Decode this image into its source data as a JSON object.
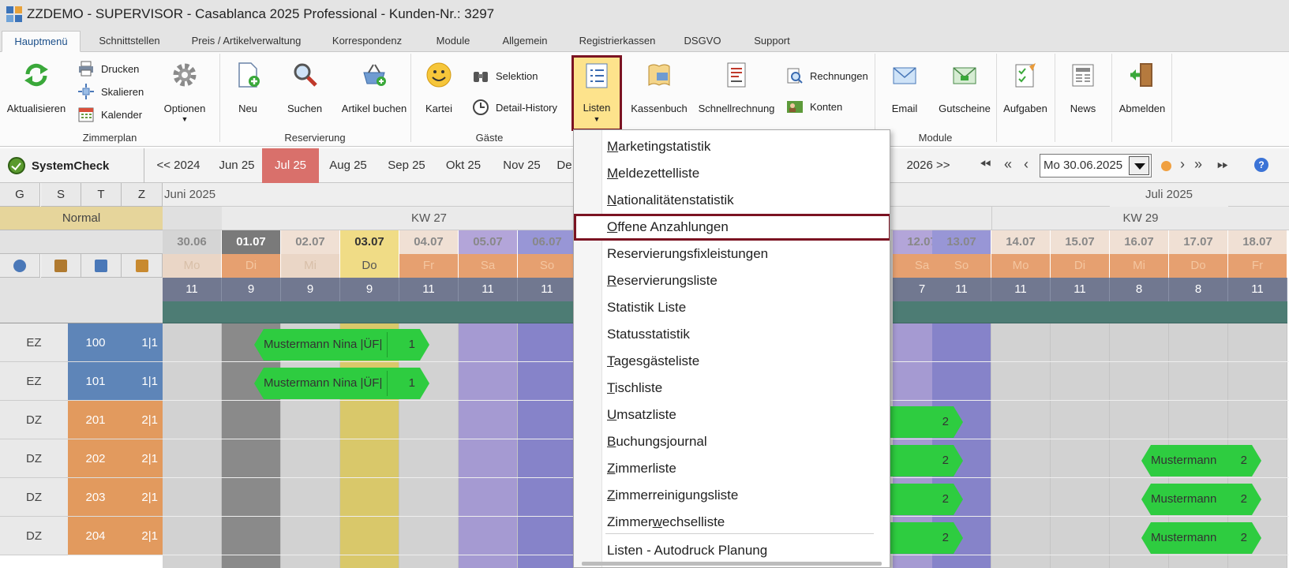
{
  "window": {
    "title": "ZZDEMO - SUPERVISOR - Casablanca 2025 Professional -  Kunden-Nr.: 3297"
  },
  "tabs": [
    "Hauptmenü",
    "Schnittstellen",
    "Preis / Artikelverwaltung",
    "Korrespondenz",
    "Module",
    "Allgemein",
    "Registrierkassen",
    "DSGVO",
    "Support"
  ],
  "ribbon": {
    "aktualisieren": "Aktualisieren",
    "drucken": "Drucken",
    "skalieren": "Skalieren",
    "kalender": "Kalender",
    "optionen": "Optionen",
    "zimmerplan": "Zimmerplan",
    "neu": "Neu",
    "suchen": "Suchen",
    "artikel_buchen": "Artikel buchen",
    "reservierung": "Reservierung",
    "kartei": "Kartei",
    "selektion": "Selektion",
    "detail_history": "Detail-History",
    "gaeste": "Gäste",
    "listen": "Listen",
    "kassenbuch": "Kassenbuch",
    "schnellrechnung": "Schnellrechnung",
    "rechnungen": "Rechnungen",
    "konten": "Konten",
    "email": "Email",
    "gutscheine": "Gutscheine",
    "aufgaben": "Aufgaben",
    "news": "News",
    "abmelden": "Abmelden",
    "module": "Module"
  },
  "nav": {
    "systemcheck": "SystemCheck",
    "months": [
      "<< 2024",
      "Jun 25",
      "Jul 25",
      "Aug 25",
      "Sep 25",
      "Okt 25",
      "Nov 25",
      "De"
    ],
    "next_year": "2026 >>",
    "date_value": "Mo  30.06.2025",
    "help": "?"
  },
  "grid": {
    "filter_headers": [
      "G",
      "S",
      "T",
      "Z"
    ],
    "category_label": "Normal",
    "month_june": "Juni 2025",
    "month_july": "Juli 2025",
    "kw27": "KW 27",
    "kw29": "KW 29",
    "days": [
      {
        "date": "30.06",
        "wd": "Mo",
        "count": "11"
      },
      {
        "date": "01.07",
        "wd": "Di",
        "count": "9"
      },
      {
        "date": "02.07",
        "wd": "Mi",
        "count": "9"
      },
      {
        "date": "03.07",
        "wd": "Do",
        "count": "9"
      },
      {
        "date": "04.07",
        "wd": "Fr",
        "count": "11"
      },
      {
        "date": "05.07",
        "wd": "Sa",
        "count": "11"
      },
      {
        "date": "06.07",
        "wd": "So",
        "count": "11"
      },
      {
        "date": "12.07",
        "wd": "Sa",
        "count": "7"
      },
      {
        "date": "13.07",
        "wd": "So",
        "count": "11"
      },
      {
        "date": "14.07",
        "wd": "Mo",
        "count": "11"
      },
      {
        "date": "15.07",
        "wd": "Di",
        "count": "11"
      },
      {
        "date": "16.07",
        "wd": "Mi",
        "count": "8"
      },
      {
        "date": "17.07",
        "wd": "Do",
        "count": "8"
      },
      {
        "date": "18.07",
        "wd": "Fr",
        "count": "11"
      }
    ],
    "rooms": [
      {
        "type": "EZ",
        "nr": "100",
        "occ": "1|1"
      },
      {
        "type": "EZ",
        "nr": "101",
        "occ": "1|1"
      },
      {
        "type": "DZ",
        "nr": "201",
        "occ": "2|1"
      },
      {
        "type": "DZ",
        "nr": "202",
        "occ": "2|1"
      },
      {
        "type": "DZ",
        "nr": "203",
        "occ": "2|1"
      },
      {
        "type": "DZ",
        "nr": "204",
        "occ": "2|1"
      }
    ],
    "bookings": [
      {
        "name": "Mustermann Nina |ÜF|",
        "count": "1"
      },
      {
        "name": "Mustermann Nina |ÜF|",
        "count": "1"
      },
      {
        "name": "",
        "count": "2"
      },
      {
        "name": "",
        "count": "2"
      },
      {
        "name": "",
        "count": "2"
      },
      {
        "name": "",
        "count": "2"
      },
      {
        "name": "Mustermann",
        "count": "2"
      },
      {
        "name": "Mustermann",
        "count": "2"
      },
      {
        "name": "Mustermann",
        "count": "2"
      }
    ]
  },
  "menu": {
    "items": [
      {
        "u": "M",
        "rest": "arketingstatistik"
      },
      {
        "u": "M",
        "rest": "eldezettelliste"
      },
      {
        "u": "N",
        "rest": "ationalitätenstatistik"
      },
      {
        "u": "O",
        "rest": "ffene Anzahlungen"
      },
      {
        "u": "",
        "rest": "Reservierungsfixleistungen"
      },
      {
        "u": "R",
        "rest": "eservierungsliste"
      },
      {
        "u": "",
        "rest": "Statistik Liste"
      },
      {
        "u": "",
        "rest": "Statusstatistik"
      },
      {
        "u": "T",
        "rest": "agesgästeliste"
      },
      {
        "u": "T",
        "rest": "ischliste"
      },
      {
        "u": "U",
        "rest": "msatzliste"
      },
      {
        "u": "B",
        "rest": "uchungsjournal"
      },
      {
        "u": "Z",
        "rest": "immerliste"
      },
      {
        "u": "Z",
        "rest": "immerreinigungsliste"
      },
      {
        "pre": "Zimmer",
        "u": "w",
        "rest": "echselliste"
      },
      {
        "u": "",
        "rest": "Listen - Autodruck Planung"
      }
    ]
  },
  "colors": {
    "accent_red": "#7b1322",
    "booking_green": "#2ecc40",
    "active_month": "#d9706b"
  }
}
